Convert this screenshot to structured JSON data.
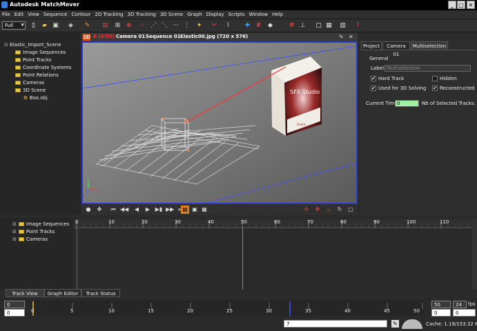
{
  "window": {
    "title": "Autodesk MatchMover",
    "min": "_",
    "max": "□",
    "close": "✕"
  },
  "menu": [
    "File",
    "Edit",
    "View",
    "Sequence",
    "Contour",
    "2D Tracking",
    "3D Tracking",
    "3D Scene",
    "Graph",
    "Display",
    "Scripts",
    "Window",
    "Help"
  ],
  "toolbar": {
    "zoom_value": "Full"
  },
  "scene_tree": {
    "root": "Elastic_Import_Scene",
    "items": [
      "Image Sequences",
      "Point Tracks",
      "Coordinate Systems",
      "Point Relations",
      "Cameras",
      "3D Scene"
    ],
    "child": "Box.obj"
  },
  "viewport": {
    "mode_badge": "2D",
    "frame": "0 (0/50)",
    "camera": "Camera 01",
    "sequence": "Sequence 01",
    "image": "Elastic00.jpg (720 x 576)",
    "box_text": "SFX Studio",
    "box_small_text": "Elastic"
  },
  "right_panel": {
    "tabs": [
      "Project",
      "Camera 01",
      "Multiselection"
    ],
    "section": "General",
    "label_caption": "Label:",
    "label_placeholder": "Multiselection",
    "hard_track": "Hard Track",
    "hidden": "Hidden",
    "used_for_3d": "Used for 3D Solving",
    "reconstructed": "Reconstructed",
    "current_time_caption": "Current Time:",
    "current_time": "0",
    "nb_tracks_caption": "Nb of Selected Tracks:"
  },
  "track_tree": {
    "items": [
      "Image Sequences",
      "Point Tracks",
      "Cameras"
    ]
  },
  "ruler": [
    "0",
    "10",
    "20",
    "30",
    "40",
    "50",
    "60",
    "70",
    "80",
    "90",
    "100",
    "110"
  ],
  "bottom_tabs": [
    "Track View",
    "Graph Editor",
    "Track Status"
  ],
  "bottom": {
    "start_value": "0",
    "start_value2": "0",
    "end_value": "50",
    "end_value2": "0",
    "fps_value": "24",
    "fps_label": "fps",
    "green_value": "0",
    "scale_ticks": [
      "0",
      "5",
      "10",
      "15",
      "20",
      "25",
      "30",
      "35",
      "40",
      "45",
      "50"
    ],
    "frame_input": "7",
    "cache": "Cache: 1.19/153.32 Mb"
  },
  "colors": {
    "viewport_border": "#2a3cc8",
    "accent_orange": "#e05010",
    "green_field": "#9ef39e",
    "yellow_field": "#ffffa8"
  }
}
